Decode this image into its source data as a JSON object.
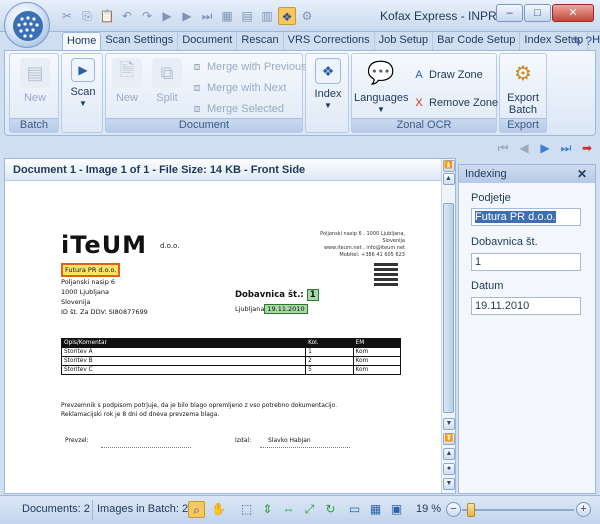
{
  "window": {
    "title": "Kofax Express - INPR...",
    "minimize": "–",
    "maximize": "□",
    "close": "✕"
  },
  "tabs": [
    {
      "label": "Home"
    },
    {
      "label": "Scan Settings"
    },
    {
      "label": "Document"
    },
    {
      "label": "Rescan"
    },
    {
      "label": "VRS Corrections"
    },
    {
      "label": "Job Setup"
    },
    {
      "label": "Bar Code Setup"
    },
    {
      "label": "Index Setup"
    },
    {
      "label": "Help"
    }
  ],
  "ribbon": {
    "batch": {
      "title": "Batch",
      "new": "New"
    },
    "scan": {
      "label": "Scan"
    },
    "document": {
      "title": "Document",
      "new": "New",
      "split": "Split",
      "merge_previous": "Merge with Previous",
      "merge_next": "Merge with Next",
      "merge_selected": "Merge Selected"
    },
    "index": {
      "label": "Index"
    },
    "zonal": {
      "title": "Zonal OCR",
      "languages": "Languages",
      "draw_zone": "Draw Zone",
      "remove_zone": "Remove Zone"
    },
    "export": {
      "title": "Export",
      "label_line1": "Export",
      "label_line2": "Batch"
    }
  },
  "document_panel": {
    "header": "Document 1 - Image 1 of 1 - File Size: 14 KB - Front Side"
  },
  "scanned_page": {
    "logo": "iTeUM",
    "logo_sub": "d.o.o.",
    "sender_address": [
      "Poljanski nasip 6 , 1000 Ljubljana, Slovenija",
      "www.iteum.net , info@iteum.net",
      "Mobitel: +386 41 605 623"
    ],
    "company_name": "Futura PR d.o.o.",
    "company_lines": [
      "Poljanski nasip 6",
      "1000 Ljubljana",
      "Slovenija",
      "ID št. Za DDV: SI80877699"
    ],
    "dobavnica_label": "Dobavnica št.:",
    "dobavnica_value": "1",
    "date_label": "Ljubljana",
    "date_value": "19.11.2010",
    "table_headers": [
      "Opis/Komentar",
      "Kol.",
      "EM"
    ],
    "table_rows": [
      [
        "Storitev A",
        "1",
        "Kom"
      ],
      [
        "Storitev B",
        "2",
        "Kom"
      ],
      [
        "Storitev C",
        "5",
        "Kom"
      ]
    ],
    "note_line1": "Prevzemnik s podpisom potrjuje, da je bilo blago opremljeno z vso potrebno dokumentacijo.",
    "note_line2": "Reklamacijski rok je 8 dni od dneva prevzema blaga.",
    "prevzel_label": "Prevzel:",
    "izdal_label": "Izdal:",
    "izdal_name": "Slavko Habjan"
  },
  "indexing": {
    "title": "Indexing",
    "close": "✕",
    "fields": [
      {
        "label": "Podjetje",
        "value": "Futura PR d.o.o."
      },
      {
        "label": "Dobavnica št.",
        "value": "1"
      },
      {
        "label": "Datum",
        "value": "19.11.2010"
      }
    ]
  },
  "statusbar": {
    "documents": "Documents: 2",
    "images": "Images in Batch: 2",
    "zoom": "19 %",
    "zoom_fraction": 0.05
  },
  "colors": {
    "accent": "#f7c760",
    "highlight_company": "#f6e36a",
    "highlight_zone": "#a8d8a8",
    "selected_text": "#3e6db5"
  }
}
